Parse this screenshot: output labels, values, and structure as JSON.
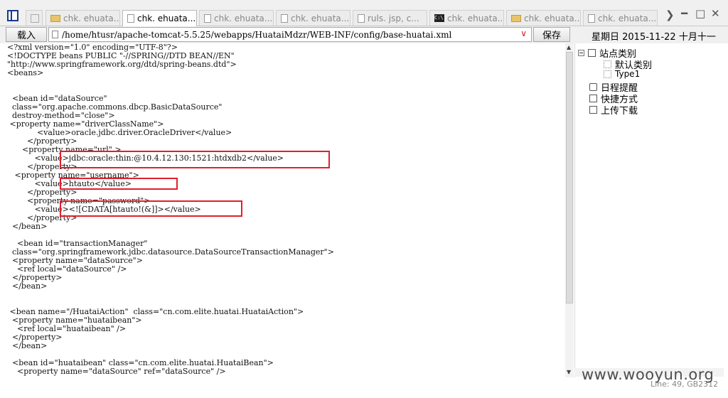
{
  "tabs": [
    {
      "label": "chk. ehuata...",
      "icon": "folder-icon"
    },
    {
      "label": "chk. ehuata...",
      "icon": "document-icon",
      "active": true
    },
    {
      "label": "chk. ehuata...",
      "icon": "document-icon"
    },
    {
      "label": "chk. ehuata...",
      "icon": "document-icon"
    },
    {
      "label": "ruls. jsp, c...",
      "icon": "document-icon"
    },
    {
      "label": "chk. ehuata...",
      "icon": "terminal-icon"
    },
    {
      "label": "chk. ehuata...",
      "icon": "folder-icon"
    },
    {
      "label": "chk. ehuata...",
      "icon": "document-icon"
    }
  ],
  "toolbar": {
    "load_label": "载入",
    "path": "/home/htusr/apache-tomcat-5.5.25/webapps/HuataiMdzr/WEB-INF/config/base-huatai.xml",
    "save_label": "保存",
    "date": "星期日  2015-11-22  十月十一"
  },
  "editor": {
    "lines": [
      "<?xml version=\"1.0\" encoding=\"UTF-8\"?>",
      "<!DOCTYPE beans PUBLIC \"-//SPRING//DTD BEAN//EN\"",
      "\"http://www.springframework.org/dtd/spring-beans.dtd\">",
      "<beans>",
      "",
      "",
      "  <bean id=\"dataSource\"",
      "  class=\"org.apache.commons.dbcp.BasicDataSource\"",
      "  destroy-method=\"close\">",
      " <property name=\"driverClassName\">",
      "            <value>oracle.jdbc.driver.OracleDriver</value>",
      "        </property>",
      "      <property name=\"url\" >",
      "           <value>jdbc:oracle:thin:@10.4.12.130:1521:htdxdb2</value>",
      "        </property>",
      "   <property name=\"username\">",
      "           <value>htauto</value>",
      "        </property>",
      "        <property name=\"password\">",
      "           <value><![CDATA[htauto!(&]]></value>",
      "        </property>",
      "  </bean>",
      "",
      "    <bean id=\"transactionManager\"",
      "  class=\"org.springframework.jdbc.datasource.DataSourceTransactionManager\">",
      "  <property name=\"dataSource\">",
      "    <ref local=\"dataSource\" />",
      "  </property>",
      "  </bean>",
      "",
      "",
      " <bean name=\"/HuataiAction\"  class=\"cn.com.elite.huatai.HuataiAction\">",
      "  <property name=\"huataibean\">",
      "    <ref local=\"huataibean\" />",
      "  </property>",
      "  </bean>",
      "",
      "  <bean id=\"huataibean\" class=\"cn.com.elite.huatai.HuataiBean\">",
      "    <property name=\"dataSource\" ref=\"dataSource\" />"
    ]
  },
  "tree": {
    "root": "站点类别",
    "children": [
      "默认类别",
      "Type1"
    ],
    "items": [
      "日程提醒",
      "快捷方式",
      "上传下载"
    ]
  },
  "status": "Line: 49, GB2312",
  "watermark": "www.wooyun.org"
}
